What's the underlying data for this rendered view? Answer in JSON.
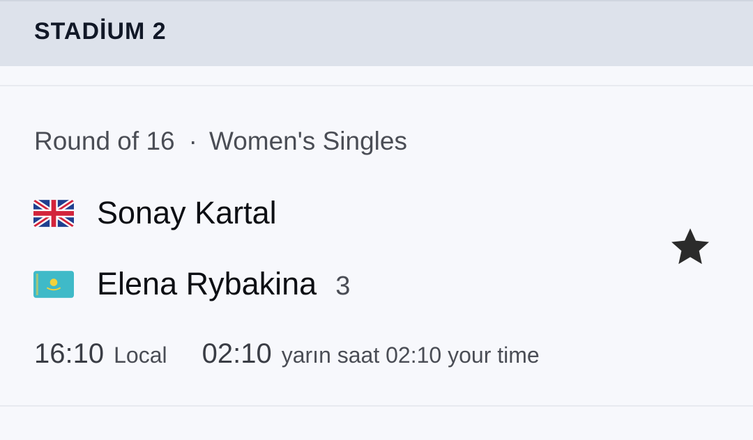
{
  "header": {
    "title": "STADİUM 2"
  },
  "match": {
    "round": "Round of 16",
    "separator": "·",
    "event": "Women's Singles",
    "players": [
      {
        "name": "Sonay Kartal",
        "flag": "united-kingdom-flag-icon",
        "seed": ""
      },
      {
        "name": "Elena Rybakina",
        "flag": "kazakhstan-flag-icon",
        "seed": "3"
      }
    ],
    "favorite_icon": "star-icon",
    "time_local": "16:10",
    "time_local_label": "Local",
    "time_user": "02:10",
    "time_user_label": "yarın saat 02:10 your time"
  },
  "colors": {
    "header_bg": "#dde2eb",
    "page_bg": "#f7f8fc",
    "star": "#2b2b2b",
    "kazakhstan_flag": "#3fbac8"
  }
}
